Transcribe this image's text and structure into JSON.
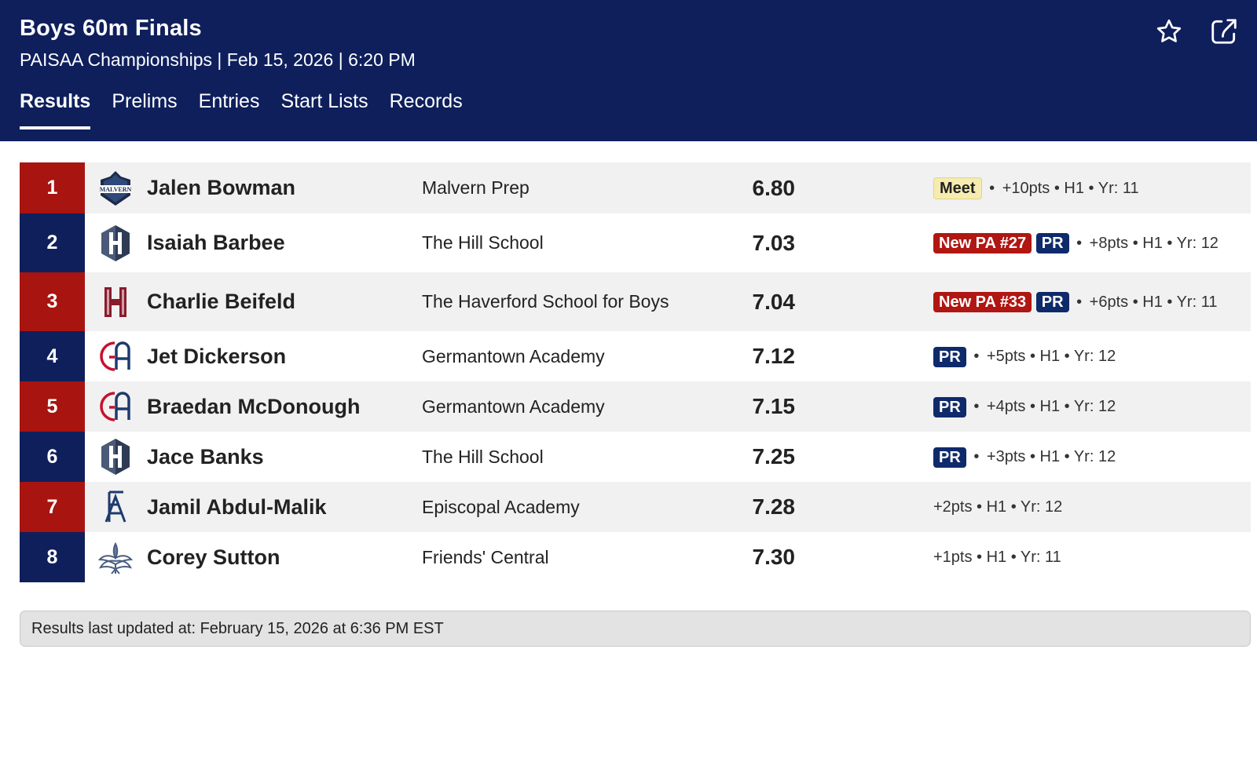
{
  "header": {
    "title": "Boys 60m Finals",
    "subtitle": "PAISAA Championships | Feb 15, 2026 | 6:20 PM",
    "actions": {
      "favorite_icon": "star-icon",
      "share_icon": "share-icon"
    }
  },
  "tabs": [
    {
      "label": "Results",
      "active": true
    },
    {
      "label": "Prelims",
      "active": false
    },
    {
      "label": "Entries",
      "active": false
    },
    {
      "label": "Start Lists",
      "active": false
    },
    {
      "label": "Records",
      "active": false
    }
  ],
  "results": [
    {
      "place": "1",
      "name": "Jalen Bowman",
      "school": "Malvern Prep",
      "mark": "6.80",
      "badges": [
        "Meet"
      ],
      "info": "+10pts • H1 • Yr: 11"
    },
    {
      "place": "2",
      "name": "Isaiah Barbee",
      "school": "The Hill School",
      "mark": "7.03",
      "badges": [
        "New PA #27",
        "PR"
      ],
      "info": "+8pts • H1 • Yr: 12"
    },
    {
      "place": "3",
      "name": "Charlie Beifeld",
      "school": "The Haverford School for Boys",
      "mark": "7.04",
      "badges": [
        "New PA #33",
        "PR"
      ],
      "info": "+6pts • H1 • Yr: 11"
    },
    {
      "place": "4",
      "name": "Jet Dickerson",
      "school": "Germantown Academy",
      "mark": "7.12",
      "badges": [
        "PR"
      ],
      "info": "+5pts • H1 • Yr: 12"
    },
    {
      "place": "5",
      "name": "Braedan McDonough",
      "school": "Germantown Academy",
      "mark": "7.15",
      "badges": [
        "PR"
      ],
      "info": "+4pts • H1 • Yr: 12"
    },
    {
      "place": "6",
      "name": "Jace Banks",
      "school": "The Hill School",
      "mark": "7.25",
      "badges": [
        "PR"
      ],
      "info": "+3pts • H1 • Yr: 12"
    },
    {
      "place": "7",
      "name": "Jamil Abdul-Malik",
      "school": "Episcopal Academy",
      "mark": "7.28",
      "badges": [],
      "info": "+2pts • H1 • Yr: 12"
    },
    {
      "place": "8",
      "name": "Corey Sutton",
      "school": "Friends' Central",
      "mark": "7.30",
      "badges": [],
      "info": "+1pts • H1 • Yr: 11"
    }
  ],
  "logo_text": {
    "malvern": "MALVERN"
  },
  "footer": {
    "text": "Results last updated at: February 15, 2026 at 6:36 PM EST"
  },
  "colors": {
    "header_bg": "#0f1f5c",
    "place_red": "#a8140f",
    "place_blue": "#0f1f5c"
  }
}
